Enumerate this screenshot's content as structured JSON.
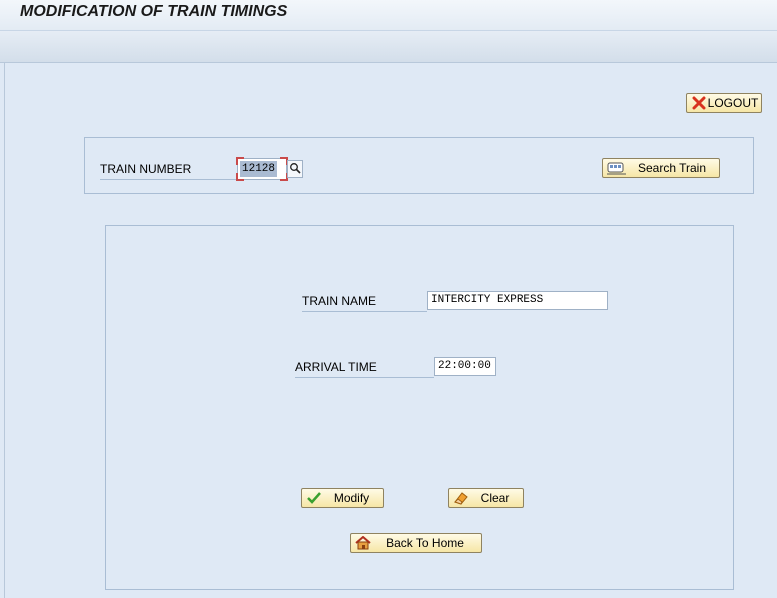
{
  "window": {
    "title": "MODIFICATION OF TRAIN TIMINGS"
  },
  "toolbar": {
    "logout_label": "LOGOUT"
  },
  "search_panel": {
    "train_number_label": "TRAIN NUMBER",
    "train_number_value": "12128",
    "search_button_label": "Search Train"
  },
  "details_panel": {
    "train_name_label": "TRAIN NAME",
    "train_name_value": "INTERCITY EXPRESS",
    "arrival_time_label": "ARRIVAL TIME",
    "arrival_time_value": "22:00:00",
    "modify_label": "Modify",
    "clear_label": "Clear",
    "back_home_label": "Back To Home"
  },
  "colors": {
    "background": "#dfe9f5",
    "button_fill": "#f6e6a6",
    "border": "#a9bdd4",
    "selection": "#c94a4a"
  },
  "icons": [
    "close-x-icon",
    "f4-help-icon",
    "train-search-icon",
    "check-icon",
    "eraser-icon",
    "home-icon"
  ]
}
